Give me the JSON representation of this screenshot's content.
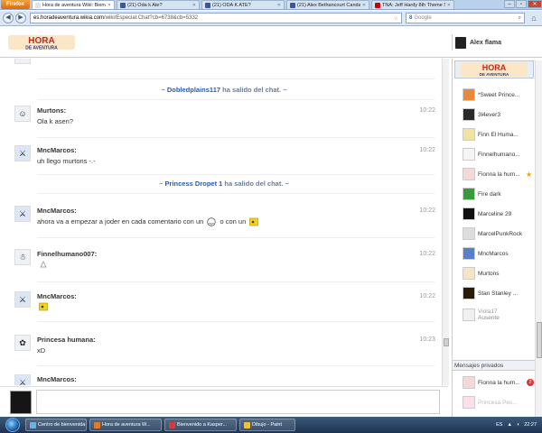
{
  "browser": {
    "menu_label": "Firefox",
    "tabs": [
      {
        "label": "Hora de aventura Wiki: Bienv...",
        "active": true,
        "favicon_color": "#e2e2e2"
      },
      {
        "label": "(21) Oda k Ate?",
        "active": false,
        "favicon_color": "#3b5998"
      },
      {
        "label": "(21) ODA K ATE?",
        "active": false,
        "favicon_color": "#3b5998"
      },
      {
        "label": "(21) Alex Bethancourt Canda...",
        "active": false,
        "favicon_color": "#3b5998"
      },
      {
        "label": "TNA: Jeff Hardy 8th Theme S...",
        "active": false,
        "favicon_color": "#cc0000"
      }
    ],
    "url_domain": "es.horadeaventura.wikia.com",
    "url_path": "/wiki/Especial:Chat?cb=6738&cb=5332",
    "search_placeholder": "Google",
    "search_engine_glyph": "8"
  },
  "header": {
    "logo_line1": "HORA",
    "logo_line2": "DE AVENTURA",
    "current_user": "Alex flama"
  },
  "chat": {
    "system_messages": [
      {
        "user": "Dobledplains117",
        "text": "ha salido del chat."
      },
      {
        "user": "Princess Dropet 1",
        "text": "ha salido del chat."
      }
    ],
    "messages": [
      {
        "user": "Murtons:",
        "text": "Ola k asen?",
        "time": "10:22",
        "avatar_icon": "character-icon"
      },
      {
        "user": "MncMarcos:",
        "text": "uh llego murtons -.-",
        "time": "10:22",
        "avatar_icon": "character-icon"
      },
      {
        "user": "MncMarcos:",
        "text_before": "ahora va a empezar a joder en cada comentario con un",
        "text_mid": "o con un",
        "time": "10:22",
        "avatar_icon": "character-icon"
      },
      {
        "user": "Finnelhumano007:",
        "text": "",
        "time": "10:22",
        "avatar_icon": "character-icon"
      },
      {
        "user": "MncMarcos:",
        "text": "",
        "time": "10:22",
        "avatar_icon": "character-icon"
      },
      {
        "user": "Princesa humana:",
        "text": "xD",
        "time": "10:23",
        "avatar_icon": "character-icon"
      },
      {
        "user": "MncMarcos:",
        "text": "",
        "time": "",
        "avatar_icon": "character-icon"
      }
    ]
  },
  "sidebar": {
    "logo_line1": "HORA",
    "logo_line2": "DE AVENTURA",
    "users": [
      {
        "name": "*Sweet Prince...",
        "color": "#e8883a",
        "sub": ""
      },
      {
        "name": "3l4ever3",
        "color": "#2a2a2a",
        "sub": ""
      },
      {
        "name": "Finn El Huma...",
        "color": "#f0e3a0",
        "sub": ""
      },
      {
        "name": "Finnelhumano...",
        "color": "#f5f5f5",
        "sub": ""
      },
      {
        "name": "Fionna la hum...",
        "color": "#f5d8d8",
        "sub": "",
        "star": "★"
      },
      {
        "name": "Fire dark",
        "color": "#3a9a3a",
        "sub": ""
      },
      {
        "name": "Marceline 29",
        "color": "#111111",
        "sub": ""
      },
      {
        "name": "MarcelPunkRock",
        "color": "#dddddd",
        "sub": ""
      },
      {
        "name": "MncMarcos",
        "color": "#5b7fc7",
        "sub": ""
      },
      {
        "name": "Murtons",
        "color": "#f3e6c8",
        "sub": ""
      },
      {
        "name": "Stan Stanley ...",
        "color": "#2a1a0a",
        "sub": ""
      },
      {
        "name": "Viola17",
        "color": "#f0f0f0",
        "sub": "Ausente",
        "away": true
      }
    ],
    "private_header": "Mensajes privados",
    "private": [
      {
        "name": "Fionna la hum...",
        "color": "#f5d8d8",
        "badge": "2"
      },
      {
        "name": "Princesa Pes...",
        "color": "#fbe0ea",
        "badge": "",
        "away": true
      }
    ]
  },
  "taskbar": {
    "buttons": [
      {
        "label": "Centro de bienvenida",
        "color": "#6fb0e0"
      },
      {
        "label": "Hora de aventura W...",
        "color": "#e07a2e"
      },
      {
        "label": "Bienvenido a Kasper...",
        "color": "#d33c3c"
      },
      {
        "label": "Dibujo - Paint",
        "color": "#f0c040"
      }
    ],
    "language": "ES",
    "clock": "22:27"
  },
  "colors": {
    "accent_link": "#2a5ab8",
    "system_text": "#6a7d94",
    "badge_red": "#d33333"
  }
}
